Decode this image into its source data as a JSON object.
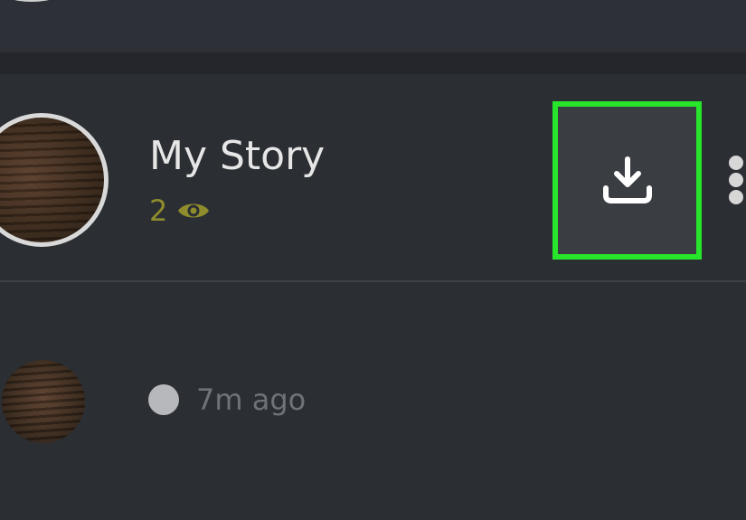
{
  "story": {
    "title": "My Story",
    "view_count": "2"
  },
  "snap": {
    "time": "7m ago"
  },
  "colors": {
    "background": "#2b2e33",
    "highlight": "#27e52b",
    "view_count": "#8e8c2c",
    "button_background": "#3a3d42"
  },
  "icons": {
    "views": "eye-icon",
    "download": "download-icon",
    "more": "more-vertical-icon",
    "status": "status-dot"
  }
}
